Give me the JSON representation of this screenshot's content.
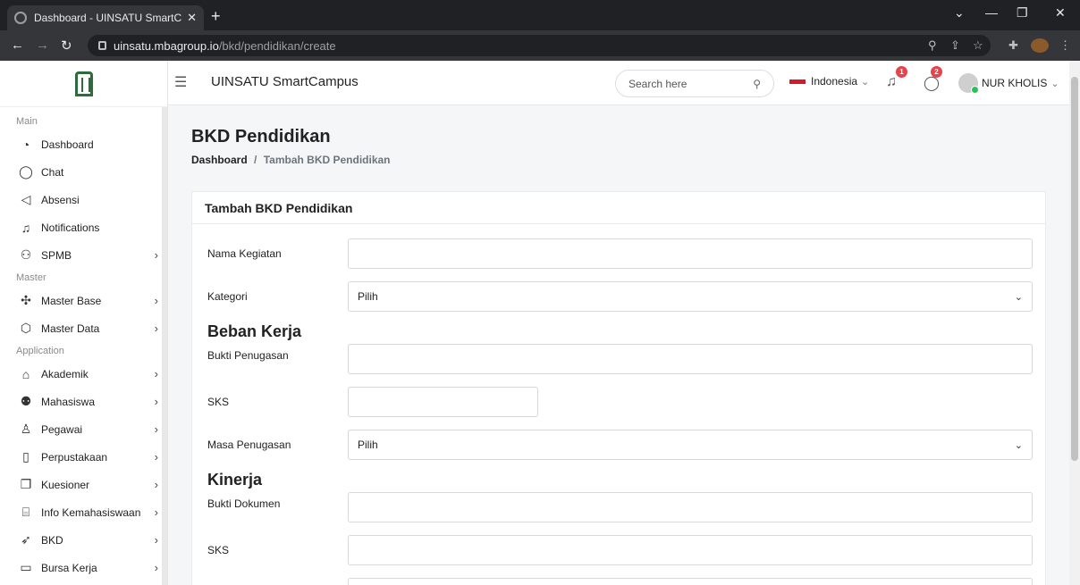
{
  "browser": {
    "tab_title": "Dashboard - UINSATU SmartCam",
    "new_tab": "+",
    "url_host": "uinsatu.mbagroup.io",
    "url_path": "/bkd/pendidikan/create"
  },
  "app": {
    "title": "UINSATU SmartCampus",
    "search_placeholder": "Search here",
    "language": "Indonesia",
    "notif_count": "1",
    "chat_count": "2",
    "user_name": "NUR KHOLIS"
  },
  "sidebar": {
    "sections": [
      {
        "label": "Main",
        "items": [
          {
            "label": "Dashboard",
            "icon": "clock-icon"
          },
          {
            "label": "Chat",
            "icon": "chat-icon"
          },
          {
            "label": "Absensi",
            "icon": "megaphone-icon"
          },
          {
            "label": "Notifications",
            "icon": "bell-icon"
          },
          {
            "label": "SPMB",
            "icon": "user-add-icon",
            "has_children": true
          }
        ]
      },
      {
        "label": "Master",
        "items": [
          {
            "label": "Master Base",
            "icon": "puzzle-icon",
            "has_children": true
          },
          {
            "label": "Master Data",
            "icon": "cube-icon",
            "has_children": true
          }
        ]
      },
      {
        "label": "Application",
        "items": [
          {
            "label": "Akademik",
            "icon": "cap-icon",
            "has_children": true
          },
          {
            "label": "Mahasiswa",
            "icon": "users-icon",
            "has_children": true
          },
          {
            "label": "Pegawai",
            "icon": "user-icon",
            "has_children": true
          },
          {
            "label": "Perpustakaan",
            "icon": "book-icon",
            "has_children": true
          },
          {
            "label": "Kuesioner",
            "icon": "copy-icon",
            "has_children": true
          },
          {
            "label": "Info Kemahasiswaan",
            "icon": "bank-icon",
            "has_children": true
          },
          {
            "label": "BKD",
            "icon": "rocket-icon",
            "has_children": true
          },
          {
            "label": "Bursa Kerja",
            "icon": "briefcase-icon",
            "has_children": true
          }
        ]
      }
    ]
  },
  "page": {
    "title": "BKD Pendidikan",
    "breadcrumb_root": "Dashboard",
    "breadcrumb_sep": "/",
    "breadcrumb_current": "Tambah BKD Pendidikan"
  },
  "form": {
    "card_title": "Tambah BKD Pendidikan",
    "nama_kegiatan_label": "Nama Kegiatan",
    "nama_kegiatan_value": "",
    "kategori_label": "Kategori",
    "kategori_value": "Pilih",
    "beban_kerja_heading": "Beban Kerja",
    "bukti_penugasan_label": "Bukti Penugasan",
    "bukti_penugasan_value": "",
    "sks1_label": "SKS",
    "sks1_value": "",
    "masa_penugasan_label": "Masa Penugasan",
    "masa_penugasan_value": "Pilih",
    "kinerja_heading": "Kinerja",
    "bukti_dokumen_label": "Bukti Dokumen",
    "bukti_dokumen_value": "",
    "sks2_label": "SKS",
    "sks2_value": ""
  },
  "colors": {
    "badge": "#e8424b",
    "flag": "#d11a2a",
    "online": "#2bc155",
    "logo": "#2b6b3c"
  }
}
